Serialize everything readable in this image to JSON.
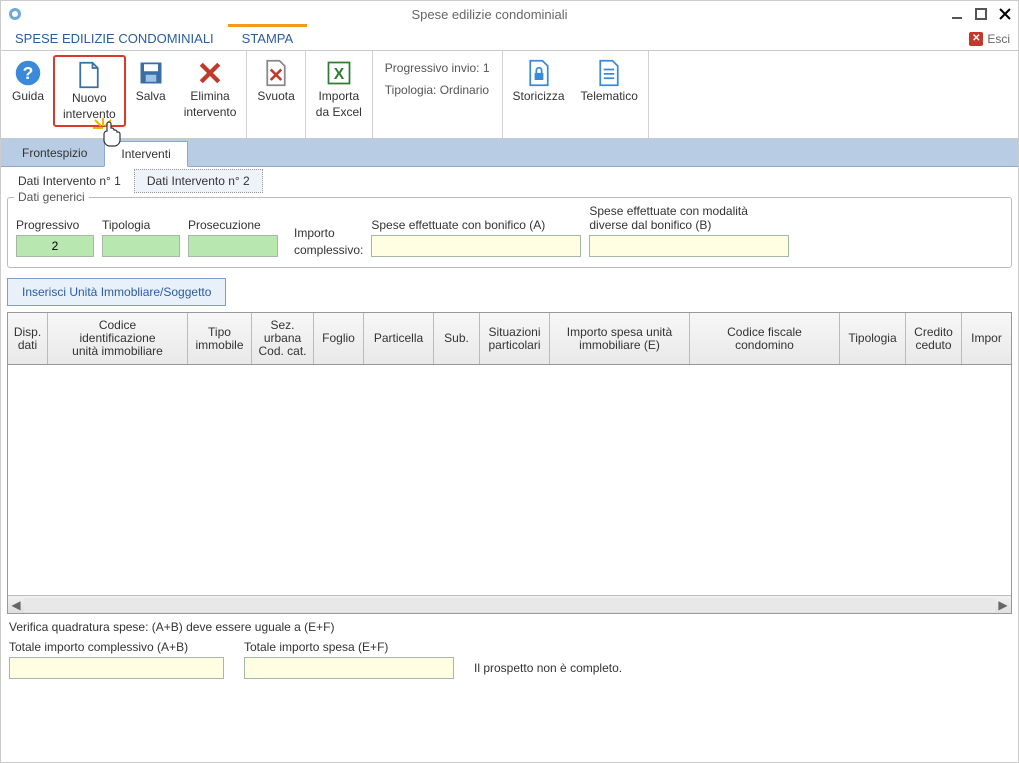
{
  "window": {
    "title": "Spese edilizie condominiali"
  },
  "top_tabs": {
    "tab1": "SPESE EDILIZIE CONDOMINIALI",
    "tab2": "STAMPA",
    "exit": "Esci"
  },
  "ribbon": {
    "guida": "Guida",
    "nuovo_l1": "Nuovo",
    "nuovo_l2": "intervento",
    "salva": "Salva",
    "elimina_l1": "Elimina",
    "elimina_l2": "intervento",
    "svuota": "Svuota",
    "importa_l1": "Importa",
    "importa_l2": "da Excel",
    "prog_invio": "Progressivo invio: 1",
    "tipologia": "Tipologia: Ordinario",
    "storicizza": "Storicizza",
    "telematico": "Telematico"
  },
  "subtabs": {
    "frontespizio": "Frontespizio",
    "interventi": "Interventi"
  },
  "inner_tabs": {
    "t1": "Dati Intervento n° 1",
    "t2": "Dati Intervento n° 2"
  },
  "generici": {
    "legend": "Dati generici",
    "progressivo_label": "Progressivo",
    "progressivo_value": "2",
    "tipologia_label": "Tipologia",
    "prosecuzione_label": "Prosecuzione",
    "importo_complessivo_l1": "Importo",
    "importo_complessivo_l2": "complessivo:",
    "spese_a": "Spese effettuate con bonifico (A)",
    "spese_b_l1": "Spese effettuate con modalità",
    "spese_b_l2": "diverse dal bonifico (B)"
  },
  "insert_btn": "Inserisci Unità Immobliare/Soggetto",
  "grid_headers": {
    "disp": "Disp.\ndati",
    "codice": "Codice\nidentificazione\nunità immobiliare",
    "tipo": "Tipo\nimmobile",
    "sez": "Sez.\nurbana\nCod. cat.",
    "foglio": "Foglio",
    "particella": "Particella",
    "sub": "Sub.",
    "situazioni": "Situazioni\nparticolari",
    "importo_e": "Importo spesa unità\nimmobiliare (E)",
    "cf": "Codice fiscale\ncondomino",
    "tipologia": "Tipologia",
    "credito": "Credito\nceduto",
    "impor": "Impor"
  },
  "bottom": {
    "verifica": "Verifica quadratura spese: (A+B) deve essere uguale a (E+F)",
    "tot_ab": "Totale importo complessivo (A+B)",
    "tot_ef": "Totale importo spesa (E+F)",
    "prospetto": "Il prospetto non è completo."
  }
}
